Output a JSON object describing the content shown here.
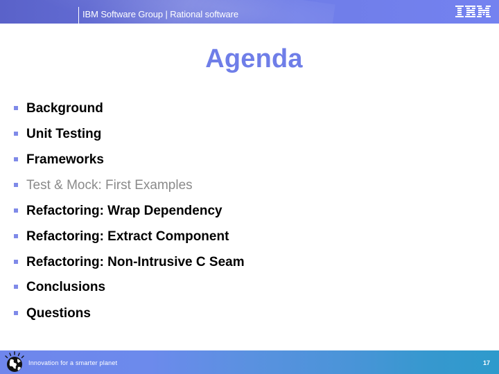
{
  "header": {
    "title": "IBM Software Group | Rational software",
    "logo": "IBM",
    "colors": {
      "band_start": "#5a62c9",
      "band_end": "#7482f0"
    }
  },
  "slide": {
    "title": "Agenda",
    "title_color": "#6f7ee8",
    "bullet_color": "#7f8ae8",
    "agenda": [
      {
        "label": "Background",
        "dimmed": false
      },
      {
        "label": "Unit Testing",
        "dimmed": false
      },
      {
        "label": "Frameworks",
        "dimmed": false
      },
      {
        "label": "Test & Mock: First Examples",
        "dimmed": true
      },
      {
        "label": "Refactoring: Wrap Dependency",
        "dimmed": false
      },
      {
        "label": "Refactoring: Extract Component",
        "dimmed": false
      },
      {
        "label": "Refactoring: Non-Intrusive C Seam",
        "dimmed": false
      },
      {
        "label": "Conclusions",
        "dimmed": false
      },
      {
        "label": "Questions",
        "dimmed": false
      }
    ]
  },
  "footer": {
    "icon": "smarter-planet-globe-icon",
    "tagline": "Innovation for a smarter planet",
    "page_number": "17",
    "colors": {
      "start": "#6f86ec",
      "end": "#2e9acc"
    }
  }
}
